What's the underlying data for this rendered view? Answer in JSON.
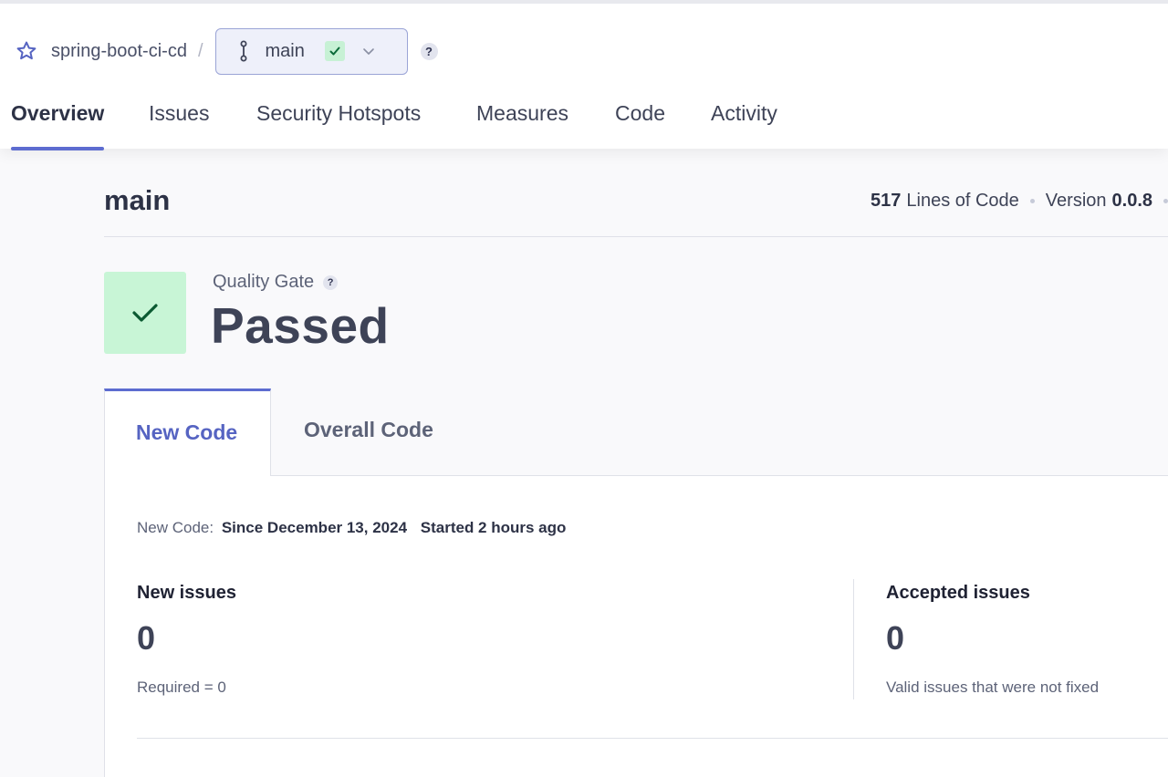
{
  "header": {
    "project_name": "spring-boot-ci-cd",
    "separator": "/",
    "branch": "main",
    "help": "?",
    "nav_tabs": [
      {
        "label": "Overview",
        "active": true
      },
      {
        "label": "Issues",
        "active": false
      },
      {
        "label": "Security Hotspots",
        "active": false
      },
      {
        "label": "Measures",
        "active": false
      },
      {
        "label": "Code",
        "active": false
      },
      {
        "label": "Activity",
        "active": false
      }
    ]
  },
  "summary": {
    "title": "main",
    "lines_of_code": "517",
    "lines_of_code_label": "Lines of Code",
    "version_label": "Version",
    "version": "0.0.8"
  },
  "quality_gate": {
    "label": "Quality Gate",
    "help": "?",
    "status": "Passed"
  },
  "tabs": {
    "new_code": "New Code",
    "overall_code": "Overall Code"
  },
  "new_code_period": {
    "label": "New Code:",
    "since": "Since December 13, 2024",
    "started": "Started 2 hours ago"
  },
  "metrics": {
    "new_issues": {
      "title": "New issues",
      "value": "0",
      "note": "Required = 0"
    },
    "accepted_issues": {
      "title": "Accepted issues",
      "value": "0",
      "note": "Valid issues that were not fixed"
    }
  },
  "colors": {
    "accent": "#5d6cd0",
    "passed_bg": "#c8f5d6",
    "passed_check": "#0b6b3a"
  }
}
